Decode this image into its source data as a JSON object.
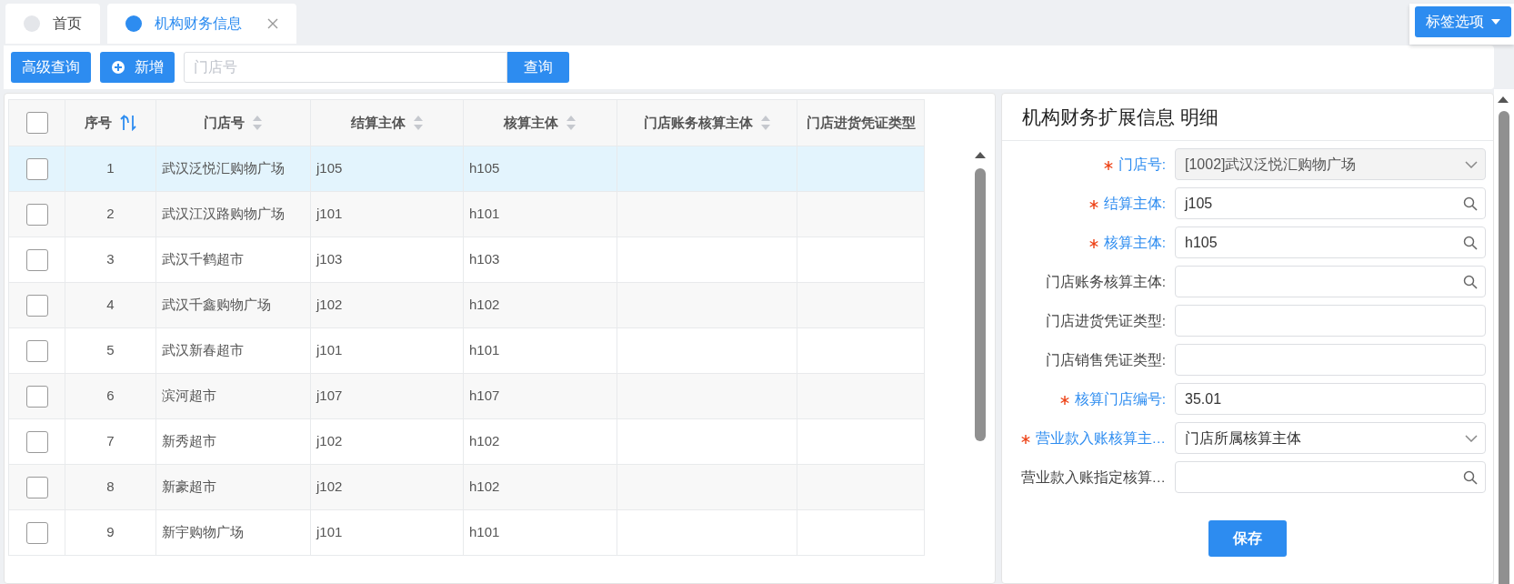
{
  "tabs": [
    {
      "label": "首页",
      "selected": false,
      "closable": false
    },
    {
      "label": "机构财务信息",
      "selected": true,
      "closable": true
    }
  ],
  "tab_options_button": "标签选项",
  "toolbar": {
    "advanced_search": "高级查询",
    "add": "新增",
    "search": {
      "placeholder": "门店号"
    },
    "query": "查询"
  },
  "table": {
    "select_all_checked": false,
    "columns": [
      {
        "label": "序号",
        "kind": "refresh"
      },
      {
        "label": "门店号",
        "kind": "sort"
      },
      {
        "label": "结算主体",
        "kind": "sort"
      },
      {
        "label": "核算主体",
        "kind": "sort"
      },
      {
        "label": "门店账务核算主体",
        "kind": "sort"
      },
      {
        "label": "门店进货凭证类型",
        "kind": "plain"
      }
    ],
    "rows": [
      {
        "no": "1",
        "store": "武汉泛悦汇购物广场",
        "settle": "j105",
        "account": "h105",
        "checked": false,
        "selected": true
      },
      {
        "no": "2",
        "store": "武汉江汉路购物广场",
        "settle": "j101",
        "account": "h101",
        "checked": false,
        "selected": false
      },
      {
        "no": "3",
        "store": "武汉千鹤超市",
        "settle": "j103",
        "account": "h103",
        "checked": false,
        "selected": false
      },
      {
        "no": "4",
        "store": "武汉千鑫购物广场",
        "settle": "j102",
        "account": "h102",
        "checked": false,
        "selected": false
      },
      {
        "no": "5",
        "store": "武汉新春超市",
        "settle": "j101",
        "account": "h101",
        "checked": false,
        "selected": false
      },
      {
        "no": "6",
        "store": "滨河超市",
        "settle": "j107",
        "account": "h107",
        "checked": false,
        "selected": false
      },
      {
        "no": "7",
        "store": "新秀超市",
        "settle": "j102",
        "account": "h102",
        "checked": false,
        "selected": false
      },
      {
        "no": "8",
        "store": "新豪超市",
        "settle": "j102",
        "account": "h102",
        "checked": false,
        "selected": false
      },
      {
        "no": "9",
        "store": "新宇购物广场",
        "settle": "j101",
        "account": "h101",
        "checked": false,
        "selected": false
      }
    ]
  },
  "detail": {
    "title": "机构财务扩展信息 明细",
    "fields": [
      {
        "label": "门店号:",
        "required": true,
        "kind": "select",
        "disabled": true,
        "value": "[1002]武汉泛悦汇购物广场"
      },
      {
        "label": "结算主体:",
        "required": true,
        "kind": "lookup",
        "disabled": false,
        "value": "j105"
      },
      {
        "label": "核算主体:",
        "required": true,
        "kind": "lookup",
        "disabled": false,
        "value": "h105"
      },
      {
        "label": "门店账务核算主体:",
        "required": false,
        "kind": "lookup",
        "disabled": false
      },
      {
        "label": "门店进货凭证类型:",
        "required": false,
        "kind": "text",
        "disabled": false
      },
      {
        "label": "门店销售凭证类型:",
        "required": false,
        "kind": "text",
        "disabled": false
      },
      {
        "label": "核算门店编号:",
        "required": true,
        "kind": "text",
        "disabled": false,
        "value": "35.01"
      },
      {
        "label": "营业款入账核算主…",
        "required": true,
        "kind": "select",
        "disabled": false,
        "value": "门店所属核算主体"
      },
      {
        "label": "营业款入账指定核算…",
        "required": false,
        "kind": "lookup",
        "disabled": false
      }
    ],
    "save": "保存"
  }
}
